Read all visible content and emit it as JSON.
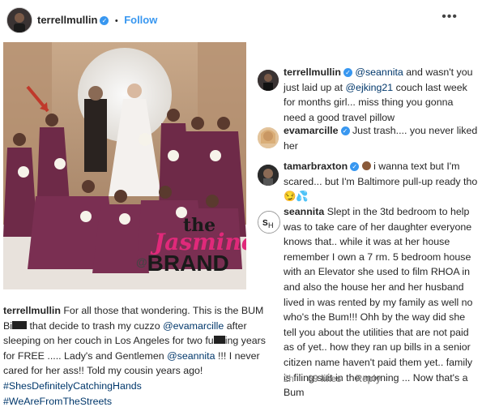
{
  "header": {
    "username": "terrellmullin",
    "separator": "•",
    "follow_label": "Follow",
    "more_icon": "more-dots-icon"
  },
  "photo": {
    "watermark_line1": "the",
    "watermark_line2": "Jasmine",
    "watermark_line3": "BRAND",
    "watermark_prefix": "@"
  },
  "caption": {
    "username": "terrellmullin",
    "text_1": " For all those that wondering. This is the BUM Bi",
    "text_2": " that decide to trash my cuzzo ",
    "mention_1": "@evamarcille",
    "text_3": " after sleeping on her couch in Los Angeles for two fu",
    "text_4": "ing years for FREE ..... Lady's and Gentlemen ",
    "mention_2": "@seannita",
    "text_5": " !!! I never cared for her ass!! Told my cousin years ago!",
    "hashtag_1": "#ShesDefinitelyCatchingHands",
    "hashtag_2": "#WeAreFromTheStreets"
  },
  "comments": [
    {
      "username": "terrellmullin",
      "mention": "@seannita",
      "text_1": " and wasn't you just laid up at ",
      "mention_2": "@ejking21",
      "text_2": " couch last week for months girl... miss thing you gonna need a good travel pillow"
    },
    {
      "username": "evamarcille",
      "text": " Just trash.... you never liked her"
    },
    {
      "username": "tamarbraxton",
      "text": " i wanna text but I'm scared... but I'm Baltimore pull-up ready tho",
      "emoji": "😏💦"
    },
    {
      "username": "seannita",
      "text": " Slept in the 3td bedroom to help was to take care of her daughter everyone knows that.. while it was at her house remember I own a 7 rm. 5 bedroom house with an Elevator she used to film RHOA in and also the house her and her husband lived  in was rented by my family as well no who's the Bum!!! Ohh by the way did she tell you about the utilities that are not paid as of yet.. how they ran up bills in a senior citizen name haven't paid them yet.. family is filing suit in the morning ... Now that's a Bum"
    }
  ],
  "footer": {
    "time": "2h",
    "likes": "69 likes",
    "reply": "Reply"
  }
}
